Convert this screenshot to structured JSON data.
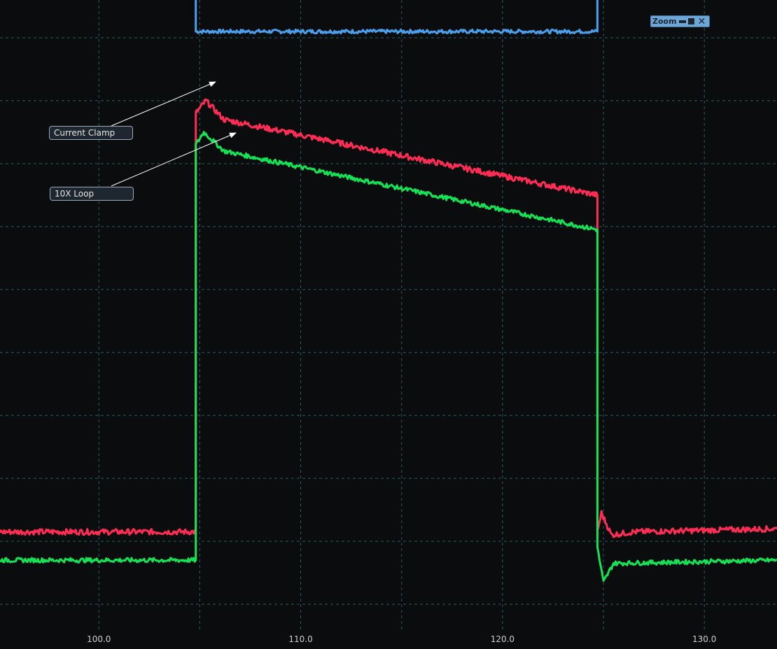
{
  "chart_data": {
    "type": "line",
    "title": "",
    "xlabel": "",
    "ylabel": "",
    "xlim": [
      95.1,
      133.6
    ],
    "x_ticks": [
      "100.0",
      "110.0",
      "120.0",
      "130.0"
    ],
    "x_tick_values": [
      100,
      110,
      120,
      130
    ],
    "ylim": [
      -0.4,
      9.6
    ],
    "grid": true,
    "series": [
      {
        "color": "#4aa0ec",
        "points": [
          [
            104.8,
            10.5
          ],
          [
            104.8,
            9.1
          ],
          [
            124.7,
            9.1
          ],
          [
            124.7,
            10.5
          ]
        ]
      },
      {
        "color": "#ff2d55",
        "points": [
          [
            95.1,
            1.15
          ],
          [
            104.8,
            1.15
          ],
          [
            104.8,
            7.8
          ],
          [
            105.3,
            8.0
          ],
          [
            106.2,
            7.7
          ],
          [
            124.7,
            6.5
          ],
          [
            124.7,
            1.15
          ],
          [
            124.9,
            1.45
          ],
          [
            125.4,
            1.1
          ],
          [
            126.5,
            1.15
          ],
          [
            133.6,
            1.2
          ]
        ]
      },
      {
        "color": "#15e355",
        "points": [
          [
            95.1,
            0.7
          ],
          [
            104.8,
            0.7
          ],
          [
            104.8,
            7.3
          ],
          [
            105.2,
            7.5
          ],
          [
            106.2,
            7.2
          ],
          [
            124.7,
            5.95
          ],
          [
            124.7,
            0.9
          ],
          [
            125.0,
            0.35
          ],
          [
            125.5,
            0.65
          ],
          [
            133.6,
            0.7
          ]
        ]
      }
    ],
    "annotations": [
      {
        "text": "Current Clamp"
      },
      {
        "text": "10X Loop"
      }
    ]
  },
  "zoom_widget": {
    "label": "Zoom"
  }
}
